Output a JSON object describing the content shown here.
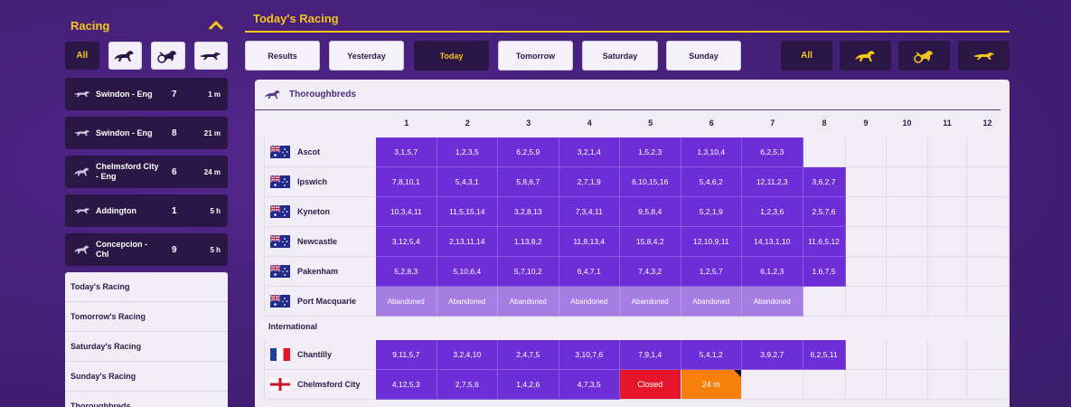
{
  "sidebar": {
    "title": "Racing",
    "filters": [
      {
        "label": "All",
        "icon": "all"
      },
      {
        "label": "",
        "icon": "horse-icon"
      },
      {
        "label": "",
        "icon": "harness-icon"
      },
      {
        "label": "",
        "icon": "greyhound-icon"
      }
    ],
    "next_to_go": [
      {
        "icon": "greyhound-icon",
        "name": "Swindon - Eng",
        "race": "7",
        "time": "1 m"
      },
      {
        "icon": "greyhound-icon",
        "name": "Swindon - Eng",
        "race": "8",
        "time": "21 m"
      },
      {
        "icon": "horse-icon",
        "name": "Chelmsford City - Eng",
        "race": "6",
        "time": "24 m"
      },
      {
        "icon": "greyhound-icon",
        "name": "Addington",
        "race": "1",
        "time": "5 h"
      },
      {
        "icon": "horse-icon",
        "name": "Concepcion - Chl",
        "race": "9",
        "time": "5 h"
      }
    ],
    "links": [
      "Today's Racing",
      "Tomorrow's Racing",
      "Saturday's Racing",
      "Sunday's Racing",
      "Thoroughbreds"
    ]
  },
  "main": {
    "title": "Today's Racing",
    "day_buttons": [
      "Results",
      "Yesterday",
      "Today",
      "Tomorrow",
      "Saturday",
      "Sunday"
    ],
    "active_day": "Today",
    "type_buttons": [
      {
        "label": "All",
        "icon": "all"
      },
      {
        "label": "",
        "icon": "horse-icon"
      },
      {
        "label": "",
        "icon": "harness-icon"
      },
      {
        "label": "",
        "icon": "greyhound-icon"
      }
    ]
  },
  "table": {
    "title": "Thoroughbreds",
    "race_numbers": [
      "1",
      "2",
      "3",
      "4",
      "5",
      "6",
      "7",
      "8",
      "9",
      "10",
      "11",
      "12"
    ],
    "section_international": "International",
    "rows": [
      {
        "venue": "Ascot",
        "flag": "AU",
        "cells": [
          {
            "t": "res",
            "v": "3,1,5,7"
          },
          {
            "t": "res",
            "v": "1,2,3,5"
          },
          {
            "t": "res",
            "v": "6,2,5,9"
          },
          {
            "t": "res",
            "v": "3,2,1,4"
          },
          {
            "t": "res",
            "v": "1,5,2,3"
          },
          {
            "t": "res",
            "v": "1,3,10,4"
          },
          {
            "t": "res",
            "v": "6,2,5,3"
          }
        ]
      },
      {
        "venue": "Ipswich",
        "flag": "AU",
        "cells": [
          {
            "t": "res",
            "v": "7,8,10,1"
          },
          {
            "t": "res",
            "v": "5,4,3,1"
          },
          {
            "t": "res",
            "v": "5,8,6,7"
          },
          {
            "t": "res",
            "v": "2,7,1,9"
          },
          {
            "t": "res",
            "v": "6,10,15,16"
          },
          {
            "t": "res",
            "v": "5,4,6,2"
          },
          {
            "t": "res",
            "v": "12,11,2,3"
          },
          {
            "t": "res",
            "v": "3,6,2,7"
          }
        ]
      },
      {
        "venue": "Kyneton",
        "flag": "AU",
        "cells": [
          {
            "t": "res",
            "v": "10,3,4,11"
          },
          {
            "t": "res",
            "v": "11,5,15,14"
          },
          {
            "t": "res",
            "v": "3,2,8,13"
          },
          {
            "t": "res",
            "v": "7,3,4,11"
          },
          {
            "t": "res",
            "v": "9,5,8,4"
          },
          {
            "t": "res",
            "v": "5,2,1,9"
          },
          {
            "t": "res",
            "v": "1,2,3,6"
          },
          {
            "t": "res",
            "v": "2,5,7,6"
          }
        ]
      },
      {
        "venue": "Newcastle",
        "flag": "AU",
        "cells": [
          {
            "t": "res",
            "v": "3,12,5,4"
          },
          {
            "t": "res",
            "v": "2,13,11,14"
          },
          {
            "t": "res",
            "v": "1,13,8,2"
          },
          {
            "t": "res",
            "v": "11,8,13,4"
          },
          {
            "t": "res",
            "v": "15,8,4,2"
          },
          {
            "t": "res",
            "v": "12,10,9,11"
          },
          {
            "t": "res",
            "v": "14,13,1,10"
          },
          {
            "t": "res",
            "v": "11,6,5,12"
          }
        ]
      },
      {
        "venue": "Pakenham",
        "flag": "AU",
        "cells": [
          {
            "t": "res",
            "v": "5,2,8,3"
          },
          {
            "t": "res",
            "v": "5,10,6,4"
          },
          {
            "t": "res",
            "v": "5,7,10,2"
          },
          {
            "t": "res",
            "v": "6,4,7,1"
          },
          {
            "t": "res",
            "v": "7,4,3,2"
          },
          {
            "t": "res",
            "v": "1,2,5,7"
          },
          {
            "t": "res",
            "v": "6,1,2,3"
          },
          {
            "t": "res",
            "v": "1,6,7,5"
          }
        ]
      },
      {
        "venue": "Port Macquarie",
        "flag": "AU",
        "cells": [
          {
            "t": "ab",
            "v": "Abandoned"
          },
          {
            "t": "ab",
            "v": "Abandoned"
          },
          {
            "t": "ab",
            "v": "Abandoned"
          },
          {
            "t": "ab",
            "v": "Abandoned"
          },
          {
            "t": "ab",
            "v": "Abandoned"
          },
          {
            "t": "ab",
            "v": "Abandoned"
          },
          {
            "t": "ab",
            "v": "Abandoned"
          }
        ]
      },
      {
        "venue": "Chantilly",
        "flag": "FR",
        "cells": [
          {
            "t": "res",
            "v": "9,11,5,7"
          },
          {
            "t": "res",
            "v": "3,2,4,10"
          },
          {
            "t": "res",
            "v": "2,4,7,5"
          },
          {
            "t": "res",
            "v": "3,10,7,6"
          },
          {
            "t": "res",
            "v": "7,9,1,4"
          },
          {
            "t": "res",
            "v": "5,4,1,2"
          },
          {
            "t": "res",
            "v": "3,9,2,7"
          },
          {
            "t": "res",
            "v": "6,2,5,11"
          }
        ]
      },
      {
        "venue": "Chelmsford City",
        "flag": "GB",
        "cells": [
          {
            "t": "res",
            "v": "4,12,5,3"
          },
          {
            "t": "res",
            "v": "2,7,5,6"
          },
          {
            "t": "res",
            "v": "1,4,2,6"
          },
          {
            "t": "res",
            "v": "4,7,3,5"
          },
          {
            "t": "closed",
            "v": "Closed"
          },
          {
            "t": "open",
            "v": "24 m"
          },
          {
            "t": "empty",
            "v": ""
          }
        ]
      }
    ]
  },
  "colors": {
    "accent": "#f5c518",
    "result": "#6d2ed8",
    "abandoned": "#a57de3",
    "closed": "#e8142b",
    "open": "#f77f0a",
    "dark": "#2a1745"
  }
}
